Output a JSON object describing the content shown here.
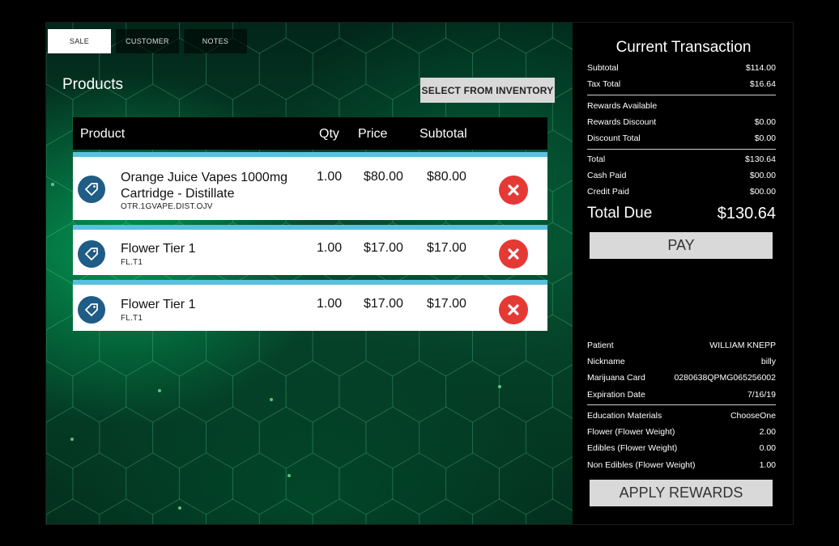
{
  "tabs": [
    {
      "label": "SALE",
      "active": true
    },
    {
      "label": "CUSTOMER",
      "active": false
    },
    {
      "label": "NOTES",
      "active": false
    }
  ],
  "products": {
    "title": "Products",
    "inventory_button": "SELECT FROM INVENTORY",
    "columns": {
      "product": "Product",
      "qty": "Qty",
      "price": "Price",
      "subtotal": "Subtotal"
    },
    "rows": [
      {
        "name": "Orange Juice Vapes 1000mg Cartridge - Distillate",
        "sku": "OTR.1GVAPE.DIST.OJV",
        "qty": "1.00",
        "price": "$80.00",
        "subtotal": "$80.00"
      },
      {
        "name": "Flower Tier 1",
        "sku": "FL.T1",
        "qty": "1.00",
        "price": "$17.00",
        "subtotal": "$17.00"
      },
      {
        "name": "Flower Tier 1",
        "sku": "FL.T1",
        "qty": "1.00",
        "price": "$17.00",
        "subtotal": "$17.00"
      }
    ]
  },
  "transaction": {
    "title": "Current Transaction",
    "subtotal_label": "Subtotal",
    "subtotal": "$114.00",
    "tax_label": "Tax Total",
    "tax": "$16.64",
    "rewards_available_label": "Rewards Available",
    "rewards_discount_label": "Rewards Discount",
    "rewards_discount": "$0.00",
    "discount_total_label": "Discount Total",
    "discount_total": "$0.00",
    "total_label": "Total",
    "total": "$130.64",
    "cash_paid_label": "Cash Paid",
    "cash_paid": "$00.00",
    "credit_paid_label": "Credit Paid",
    "credit_paid": "$00.00",
    "total_due_label": "Total Due",
    "total_due": "$130.64",
    "pay_button": "PAY"
  },
  "patient": {
    "patient_label": "Patient",
    "patient": "WILLIAM KNEPP",
    "nickname_label": "Nickname",
    "nickname": "billy",
    "card_label": "Marijuana Card",
    "card": "0280638QPMG065256002",
    "expiration_label": "Expiration Date",
    "expiration": "7/16/19",
    "education_label": "Education Materials",
    "education": "ChooseOne",
    "flower_label": "Flower (Flower Weight)",
    "flower": "2.00",
    "edibles_label": "Edibles (Flower Weight)",
    "edibles": "0.00",
    "non_edibles_label": "Non Edibles (Flower Weight)",
    "non_edibles": "1.00",
    "rewards_button": "APPLY REWARDS"
  },
  "colors": {
    "accent_blue": "#5bc0de",
    "delete_red": "#e53935",
    "tag_blue": "#1f5c86"
  }
}
